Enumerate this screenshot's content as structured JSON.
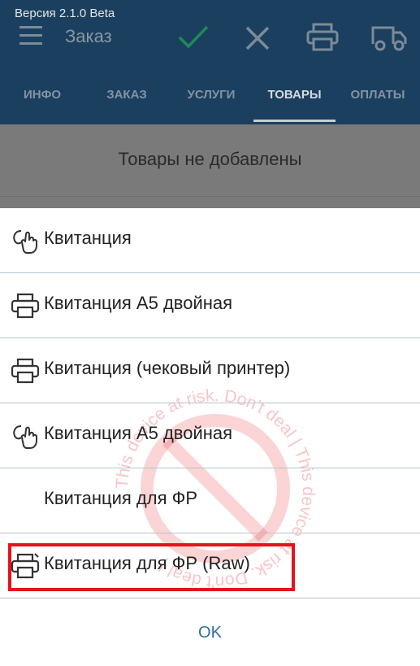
{
  "status_bar": {
    "version": "Версия 2.1.0 Beta"
  },
  "toolbar": {
    "title": "Заказ",
    "icons": [
      "menu-icon",
      "check-icon",
      "close-icon",
      "printer-icon",
      "truck-icon"
    ]
  },
  "tabs": [
    {
      "label": "ИНФО",
      "active": false
    },
    {
      "label": "ЗАКАЗ",
      "active": false
    },
    {
      "label": "УСЛУГИ",
      "active": false
    },
    {
      "label": "ТОВАРЫ",
      "active": true
    },
    {
      "label": "ОПЛАТЫ",
      "active": false
    }
  ],
  "content": {
    "empty_message": "Товары не добавлены"
  },
  "dialog": {
    "items": [
      {
        "label": "Квитанция",
        "icon": "hand-pointer-icon"
      },
      {
        "label": "Квитанция А5 двойная",
        "icon": "printer-icon"
      },
      {
        "label": "Квитанция (чековый принтер)",
        "icon": "printer-icon"
      },
      {
        "label": "Квитанция А5 двойная",
        "icon": "hand-pointer-icon"
      },
      {
        "label": "Квитанция для ФР",
        "icon": ""
      },
      {
        "label": "Квитанция для ФР (Raw)",
        "icon": "printer-raw-icon",
        "highlighted": true
      }
    ],
    "ok_label": "OK"
  },
  "watermark": {
    "text": "This device at risk. Don't deal | This device at risk. Don't deal |"
  },
  "colors": {
    "appbar": "#1b3f5e",
    "accent": "#2f6ea5",
    "highlight": "#e8121b",
    "watermark": "#e8121b"
  }
}
